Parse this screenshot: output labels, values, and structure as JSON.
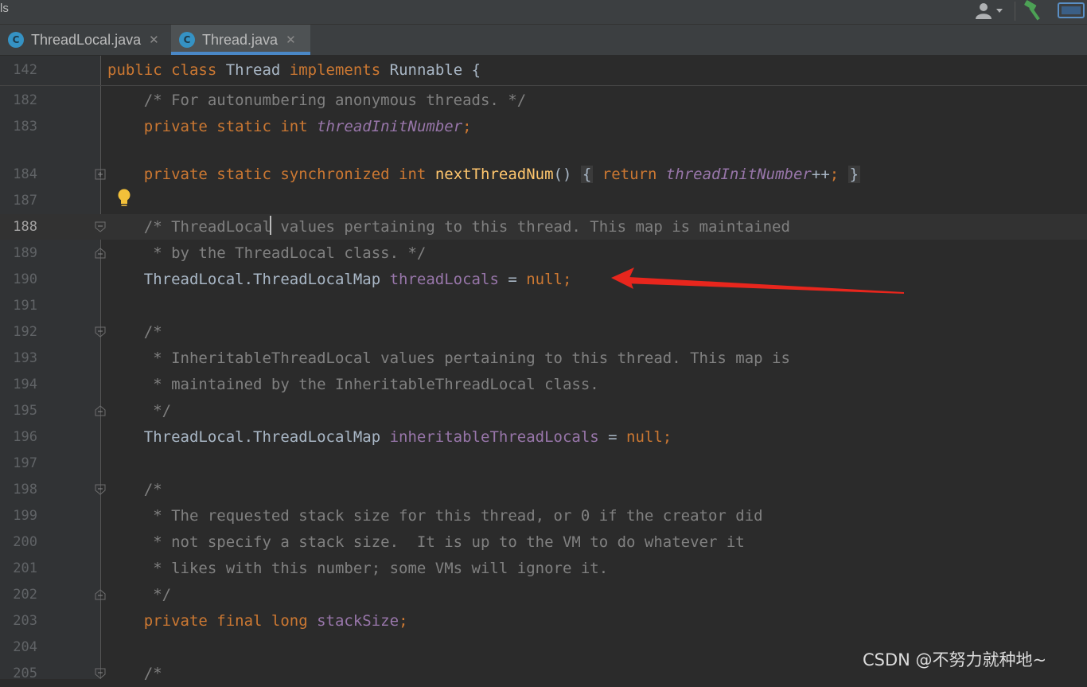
{
  "topbar": {
    "left_fragment": "ls"
  },
  "tabs": [
    {
      "label": "ThreadLocal.java",
      "icon": "C",
      "active": false
    },
    {
      "label": "Thread.java",
      "icon": "C",
      "active": true
    }
  ],
  "editor": {
    "sticky": {
      "line": "142",
      "tokens": [
        {
          "t": "kw",
          "v": "public class "
        },
        {
          "t": "txt",
          "v": "Thread "
        },
        {
          "t": "kw",
          "v": "implements "
        },
        {
          "t": "txt",
          "v": "Runnable {"
        }
      ]
    },
    "lines": [
      {
        "n": "182",
        "tokens": [
          {
            "t": "cm",
            "v": "    /* For autonumbering anonymous threads. */"
          }
        ]
      },
      {
        "n": "183",
        "tokens": [
          {
            "t": "kw",
            "v": "    private static int "
          },
          {
            "t": "ifld",
            "v": "threadInitNumber"
          },
          {
            "t": "kw",
            "v": ";"
          }
        ]
      },
      {
        "n": "184",
        "tokens": [
          {
            "t": "kw",
            "v": "    private static synchronized int "
          },
          {
            "t": "fn",
            "v": "nextThreadNum"
          },
          {
            "t": "txt",
            "v": "() "
          },
          {
            "t": "box",
            "v": "{"
          },
          {
            "t": "txt",
            "v": " "
          },
          {
            "t": "kw",
            "v": "return "
          },
          {
            "t": "ifld",
            "v": "threadInitNumber"
          },
          {
            "t": "txt",
            "v": "++"
          },
          {
            "t": "kw",
            "v": ";"
          },
          {
            "t": "txt",
            "v": " "
          },
          {
            "t": "box",
            "v": "}"
          }
        ]
      },
      {
        "n": "187",
        "tokens": []
      },
      {
        "n": "188",
        "current": true,
        "tokens": [
          {
            "t": "cm",
            "v": "    /* ThreadLocal values pertaining to this thread. This map is maintained"
          }
        ]
      },
      {
        "n": "189",
        "tokens": [
          {
            "t": "cm",
            "v": "     * by the ThreadLocal class. */"
          }
        ]
      },
      {
        "n": "190",
        "tokens": [
          {
            "t": "txt",
            "v": "    ThreadLocal.ThreadLocalMap "
          },
          {
            "t": "fld",
            "v": "threadLocals"
          },
          {
            "t": "txt",
            "v": " = "
          },
          {
            "t": "kw",
            "v": "null;"
          }
        ]
      },
      {
        "n": "191",
        "tokens": []
      },
      {
        "n": "192",
        "tokens": [
          {
            "t": "cm",
            "v": "    /*"
          }
        ]
      },
      {
        "n": "193",
        "tokens": [
          {
            "t": "cm",
            "v": "     * InheritableThreadLocal values pertaining to this thread. This map is"
          }
        ]
      },
      {
        "n": "194",
        "tokens": [
          {
            "t": "cm",
            "v": "     * maintained by the InheritableThreadLocal class."
          }
        ]
      },
      {
        "n": "195",
        "tokens": [
          {
            "t": "cm",
            "v": "     */"
          }
        ]
      },
      {
        "n": "196",
        "tokens": [
          {
            "t": "txt",
            "v": "    ThreadLocal.ThreadLocalMap "
          },
          {
            "t": "fld",
            "v": "inheritableThreadLocals"
          },
          {
            "t": "txt",
            "v": " = "
          },
          {
            "t": "kw",
            "v": "null;"
          }
        ]
      },
      {
        "n": "197",
        "tokens": []
      },
      {
        "n": "198",
        "tokens": [
          {
            "t": "cm",
            "v": "    /*"
          }
        ]
      },
      {
        "n": "199",
        "tokens": [
          {
            "t": "cm",
            "v": "     * The requested stack size for this thread, or 0 if the creator did"
          }
        ]
      },
      {
        "n": "200",
        "tokens": [
          {
            "t": "cm",
            "v": "     * not specify a stack size.  It is up to the VM to do whatever it"
          }
        ]
      },
      {
        "n": "201",
        "tokens": [
          {
            "t": "cm",
            "v": "     * likes with this number; some VMs will ignore it."
          }
        ]
      },
      {
        "n": "202",
        "tokens": [
          {
            "t": "cm",
            "v": "     */"
          }
        ]
      },
      {
        "n": "203",
        "tokens": [
          {
            "t": "kw",
            "v": "    private final long "
          },
          {
            "t": "fld",
            "v": "stackSize"
          },
          {
            "t": "kw",
            "v": ";"
          }
        ]
      },
      {
        "n": "204",
        "tokens": []
      },
      {
        "n": "205",
        "tokens": [
          {
            "t": "cm",
            "v": "    /*"
          }
        ]
      }
    ]
  },
  "colors": {
    "keyword": "#cc7832",
    "comment": "#808080",
    "field": "#9876aa",
    "method": "#ffc66d",
    "text": "#a9b7c6",
    "annotation_arrow": "#e8261d"
  },
  "watermark": "CSDN @不努力就种地~"
}
